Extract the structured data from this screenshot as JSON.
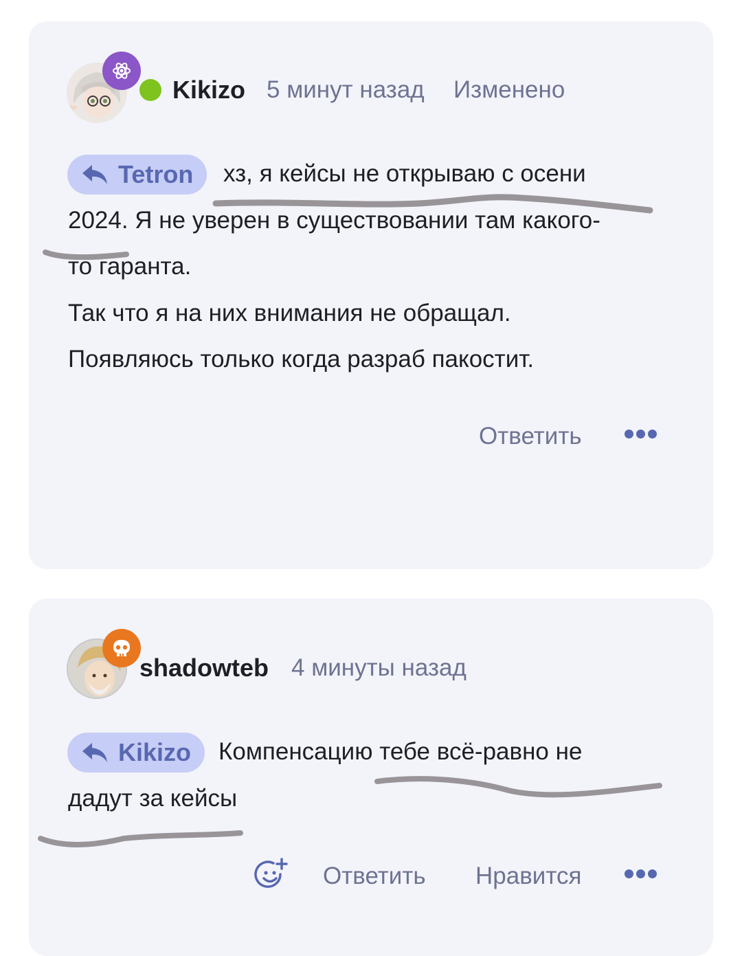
{
  "colors": {
    "card_bg": "#f3f4fa",
    "text": "#1e1f24",
    "muted": "#6e7392",
    "chip_bg": "#c6cdf6",
    "chip_text": "#5868b0",
    "online": "#7fc31f",
    "badge_purple": "#8b56c8",
    "badge_orange": "#e8771f",
    "pen": "#8f8a8d",
    "dots": "#5868b0"
  },
  "comments": [
    {
      "author": "Kikizo",
      "time": "5 минут назад",
      "edited": "Изменено",
      "badge_icon": "atom-icon",
      "reply_to": "Tetron",
      "lines": [
        "хз, я кейсы не открываю с осени",
        "2024. Я не уверен в существовании там какого-",
        "то гаранта.",
        "Так что я на них внимания не обращал.",
        "Появляюсь только когда разраб пакостит."
      ],
      "actions": {
        "reply": "Ответить"
      }
    },
    {
      "author": "shadowteb",
      "time": "4 минуты назад",
      "badge_icon": "skull-icon",
      "reply_to": "Kikizo",
      "lines": [
        "Компенсацию тебе всё-равно не",
        "дадут за кейсы"
      ],
      "actions": {
        "reply": "Ответить",
        "like": "Нравится"
      }
    }
  ]
}
